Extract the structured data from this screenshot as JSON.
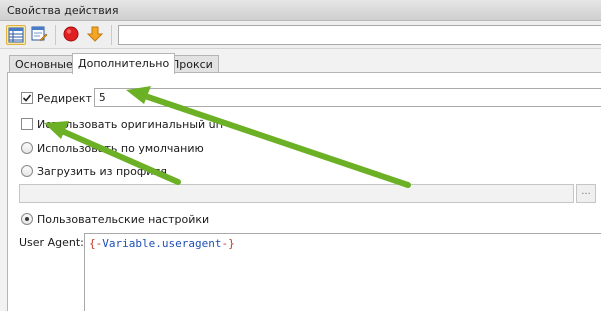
{
  "window": {
    "title": "Свойства действия"
  },
  "toolbar": {
    "buttons": [
      "table-view-icon",
      "edit-script-icon",
      "stop-icon",
      "down-arrow-icon"
    ],
    "input_value": ""
  },
  "tabs": [
    {
      "label": "Основные",
      "active": false
    },
    {
      "label": "Дополнительно",
      "active": true
    },
    {
      "label": "Прокси",
      "active": false
    }
  ],
  "form": {
    "redirect": {
      "label": "Редирект",
      "checked": true,
      "value": "5"
    },
    "use_original_url": {
      "label": "Использовать оригинальный url",
      "checked": false
    },
    "use_default": {
      "label": "Использовать по умолчанию",
      "checked": false
    },
    "load_from_profile": {
      "label": "Загрузить из профиля",
      "checked": false,
      "path": "",
      "browse_label": "..."
    },
    "custom_settings": {
      "label": "Пользовательские настройки",
      "checked": true
    },
    "user_agent": {
      "label": "User Agent:",
      "brace_open": "{-",
      "variable": "Variable.useragent",
      "brace_close": "-}"
    }
  },
  "colors": {
    "arrow": "#6cb026",
    "accent_highlight": "#fde9a6",
    "variable_blue": "#1f4fb5",
    "brace_red": "#c0392b"
  }
}
